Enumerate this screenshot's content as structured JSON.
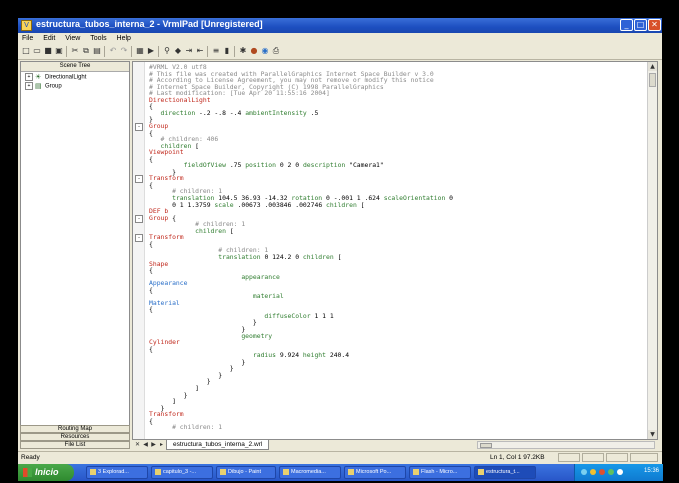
{
  "window": {
    "title": "estructura_tubos_interna_2 - VrmlPad [Unregistered]",
    "controls": {
      "minimize": "_",
      "maximize": "□",
      "close": "✕"
    }
  },
  "menu": [
    "File",
    "Edit",
    "View",
    "Tools",
    "Help"
  ],
  "toolbar_icons": [
    "new-file-icon",
    "open-file-icon",
    "save-icon",
    "save-all-icon",
    "cut-icon",
    "copy-icon",
    "paste-icon",
    "undo-icon",
    "redo-icon",
    "scene-tree-icon",
    "preview-icon",
    "find-icon",
    "bookmark-icon",
    "indent-icon",
    "outdent-icon",
    "comment-icon",
    "stop-icon",
    "node-icon",
    "color-icon",
    "browser-icon",
    "print-icon"
  ],
  "scene_tree": {
    "header": "Scene Tree",
    "items": [
      {
        "label": "DirectionalLight",
        "expander": "+"
      },
      {
        "label": "Group",
        "expander": "+"
      }
    ]
  },
  "left_tabs": [
    "Routing Map",
    "Resources",
    "File List"
  ],
  "code_lines": [
    [
      {
        "t": "#VRML V2.0 utf8",
        "c": "com"
      }
    ],
    [
      {
        "t": "# This file was created with ParallelGraphics Internet Space Builder v 3.0",
        "c": "com"
      }
    ],
    [
      {
        "t": "# According to License Agreement, you may not remove or modify this notice",
        "c": "com"
      }
    ],
    [
      {
        "t": "# Internet Space Builder, Copyright (C) 1998 ParallelGraphics",
        "c": "com"
      }
    ],
    [
      {
        "t": "# Last modification: [Tue Apr 20 11:55:16 2004]",
        "c": "com"
      }
    ],
    [
      {
        "t": "DirectionalLight",
        "c": "kw"
      }
    ],
    [
      {
        "t": "{",
        "c": "txt"
      }
    ],
    [
      {
        "t": "   direction ",
        "c": "fld"
      },
      {
        "t": "-.2 -.8 -.4 ",
        "c": "txt"
      },
      {
        "t": "ambientIntensity ",
        "c": "fld"
      },
      {
        "t": ".5",
        "c": "txt"
      }
    ],
    [
      {
        "t": "}",
        "c": "txt"
      }
    ],
    [
      {
        "t": "Group",
        "c": "kw"
      }
    ],
    [
      {
        "t": "{",
        "c": "txt"
      }
    ],
    [
      {
        "t": "   # children: 406",
        "c": "com"
      }
    ],
    [
      {
        "t": "   children ",
        "c": "fld"
      },
      {
        "t": "[",
        "c": "txt"
      }
    ],
    [
      {
        "t": "Viewpoint",
        "c": "kw"
      }
    ],
    [
      {
        "t": "{",
        "c": "txt"
      }
    ],
    [
      {
        "t": "         fieldOfView ",
        "c": "fld"
      },
      {
        "t": ".75 ",
        "c": "txt"
      },
      {
        "t": "position ",
        "c": "fld"
      },
      {
        "t": "0 2 0 ",
        "c": "txt"
      },
      {
        "t": "description ",
        "c": "fld"
      },
      {
        "t": "\"Camera1\"",
        "c": "txt"
      }
    ],
    [
      {
        "t": "      }",
        "c": "txt"
      }
    ],
    [
      {
        "t": "Transform",
        "c": "kw"
      }
    ],
    [
      {
        "t": "{",
        "c": "txt"
      }
    ],
    [
      {
        "t": "      # children: 1",
        "c": "com"
      }
    ],
    [
      {
        "t": "      translation ",
        "c": "fld"
      },
      {
        "t": "104.5 36.93 -14.32 ",
        "c": "txt"
      },
      {
        "t": "rotation ",
        "c": "fld"
      },
      {
        "t": "0 -.001 1 .624 ",
        "c": "txt"
      },
      {
        "t": "scaleOrientation ",
        "c": "fld"
      },
      {
        "t": "0",
        "c": "txt"
      }
    ],
    [
      {
        "t": "      0 1 1.3759 ",
        "c": "txt"
      },
      {
        "t": "scale ",
        "c": "fld"
      },
      {
        "t": ".00673 .003846 .002746 ",
        "c": "txt"
      },
      {
        "t": "children ",
        "c": "fld"
      },
      {
        "t": "[",
        "c": "txt"
      }
    ],
    [
      {
        "t": "DEF b",
        "c": "kw"
      }
    ],
    [
      {
        "t": "Group",
        "c": "kw"
      },
      {
        "t": " {",
        "c": "txt"
      }
    ],
    [
      {
        "t": "            # children: 1",
        "c": "com"
      }
    ],
    [
      {
        "t": "            children ",
        "c": "fld"
      },
      {
        "t": "[",
        "c": "txt"
      }
    ],
    [
      {
        "t": "Transform",
        "c": "kw"
      }
    ],
    [
      {
        "t": "{",
        "c": "txt"
      }
    ],
    [
      {
        "t": "                  # children: 1",
        "c": "com"
      }
    ],
    [
      {
        "t": "                  translation ",
        "c": "fld"
      },
      {
        "t": "0 124.2 0 ",
        "c": "txt"
      },
      {
        "t": "children ",
        "c": "fld"
      },
      {
        "t": "[",
        "c": "txt"
      }
    ],
    [
      {
        "t": "Shape",
        "c": "kw"
      }
    ],
    [
      {
        "t": "{",
        "c": "txt"
      }
    ],
    [
      {
        "t": "                        appearance",
        "c": "fld"
      }
    ],
    [
      {
        "t": "Appearance",
        "c": "app"
      }
    ],
    [
      {
        "t": "{",
        "c": "txt"
      }
    ],
    [
      {
        "t": "                           material",
        "c": "fld"
      }
    ],
    [
      {
        "t": "Material",
        "c": "app"
      }
    ],
    [
      {
        "t": "{",
        "c": "txt"
      }
    ],
    [
      {
        "t": "                              diffuseColor ",
        "c": "fld"
      },
      {
        "t": "1 1 1",
        "c": "txt"
      }
    ],
    [
      {
        "t": "                           }",
        "c": "txt"
      }
    ],
    [
      {
        "t": "                        }",
        "c": "txt"
      }
    ],
    [
      {
        "t": "                        geometry",
        "c": "fld"
      }
    ],
    [
      {
        "t": "Cylinder",
        "c": "kw"
      }
    ],
    [
      {
        "t": "{",
        "c": "txt"
      }
    ],
    [
      {
        "t": "                           radius ",
        "c": "fld"
      },
      {
        "t": "9.924 ",
        "c": "txt"
      },
      {
        "t": "height ",
        "c": "fld"
      },
      {
        "t": "240.4",
        "c": "txt"
      }
    ],
    [
      {
        "t": "                        }",
        "c": "txt"
      }
    ],
    [
      {
        "t": "                     }",
        "c": "txt"
      }
    ],
    [
      {
        "t": "                  }",
        "c": "txt"
      }
    ],
    [
      {
        "t": "               }",
        "c": "txt"
      }
    ],
    [
      {
        "t": "            ]",
        "c": "txt"
      }
    ],
    [
      {
        "t": "         }",
        "c": "txt"
      }
    ],
    [
      {
        "t": "      ]",
        "c": "txt"
      }
    ],
    [
      {
        "t": "   }",
        "c": "txt"
      }
    ],
    [
      {
        "t": "Transform",
        "c": "kw"
      }
    ],
    [
      {
        "t": "{",
        "c": "txt"
      }
    ],
    [
      {
        "t": "      # children: 1",
        "c": "com"
      }
    ]
  ],
  "colors": {
    "comment": "#8a8a8a",
    "keyword": "#c0281c",
    "field": "#2f7d2f",
    "appearance": "#2a6fc8",
    "titlebar": "#1d4fc0"
  },
  "file_tab": "estructura_tubos_interna_2.wrl",
  "status": {
    "text": "Ready",
    "position": "Ln 1, Col 1   97.2KB"
  },
  "taskbar": {
    "start": "Inicio",
    "tasks": [
      "3 Explorad...",
      "capitulo_3 -...",
      "Dibujo - Paint",
      "Macromedia...",
      "Microsoft Po...",
      "Flash - Micro...",
      "estructura_t..."
    ],
    "clock": "15:36"
  }
}
